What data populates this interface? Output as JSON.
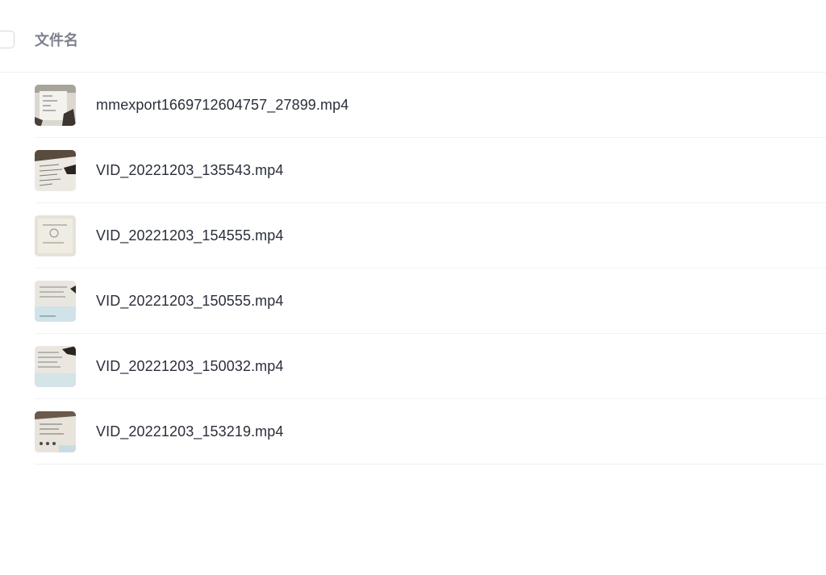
{
  "header": {
    "column_title": "文件名"
  },
  "files": [
    {
      "name": "mmexport1669712604757_27899.mp4",
      "thumbnail_icon": "video-thumbnail"
    },
    {
      "name": "VID_20221203_135543.mp4",
      "thumbnail_icon": "video-thumbnail"
    },
    {
      "name": "VID_20221203_154555.mp4",
      "thumbnail_icon": "video-thumbnail"
    },
    {
      "name": "VID_20221203_150555.mp4",
      "thumbnail_icon": "video-thumbnail"
    },
    {
      "name": "VID_20221203_150032.mp4",
      "thumbnail_icon": "video-thumbnail"
    },
    {
      "name": "VID_20221203_153219.mp4",
      "thumbnail_icon": "video-thumbnail"
    }
  ]
}
